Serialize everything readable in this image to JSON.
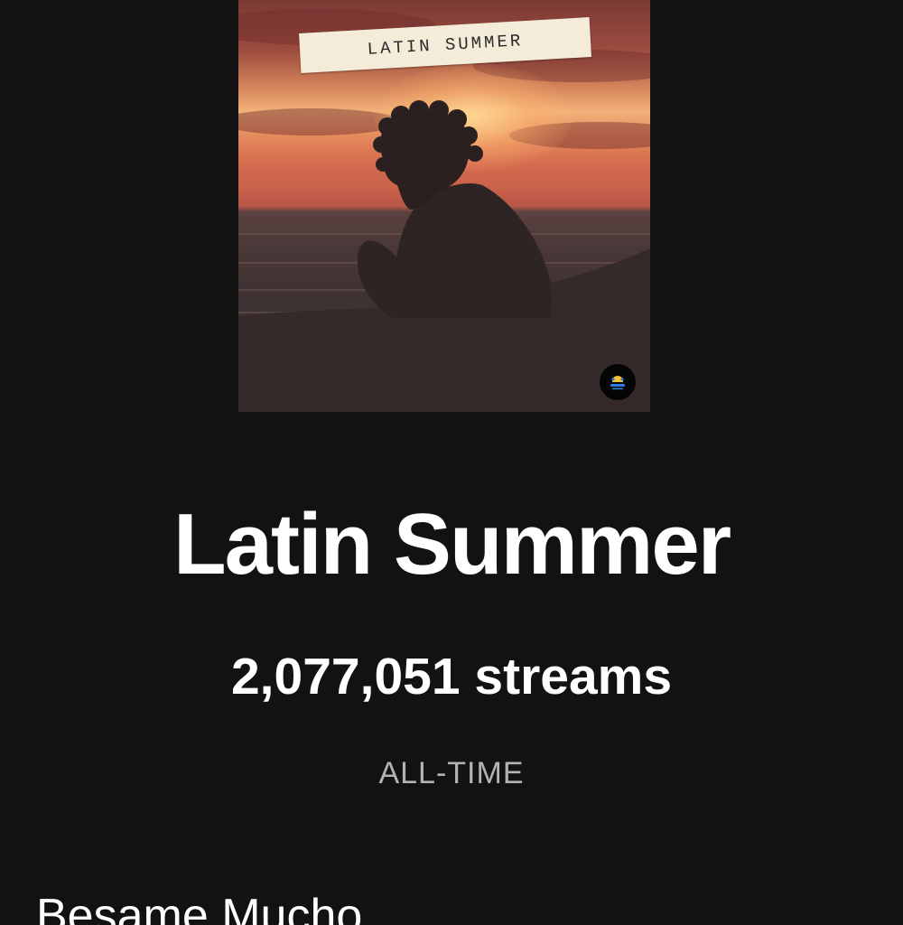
{
  "album": {
    "cover_label": "LATIN SUMMER",
    "cover_logo_icon": "label-logo-icon",
    "title": "Latin Summer",
    "streams_text": "2,077,051 streams",
    "period": "ALL-TIME"
  },
  "tracks": [
    {
      "name": "Besame Mucho"
    }
  ],
  "colors": {
    "background": "#121212",
    "primary_text": "#ffffff",
    "secondary_text": "#b3b3b3"
  }
}
